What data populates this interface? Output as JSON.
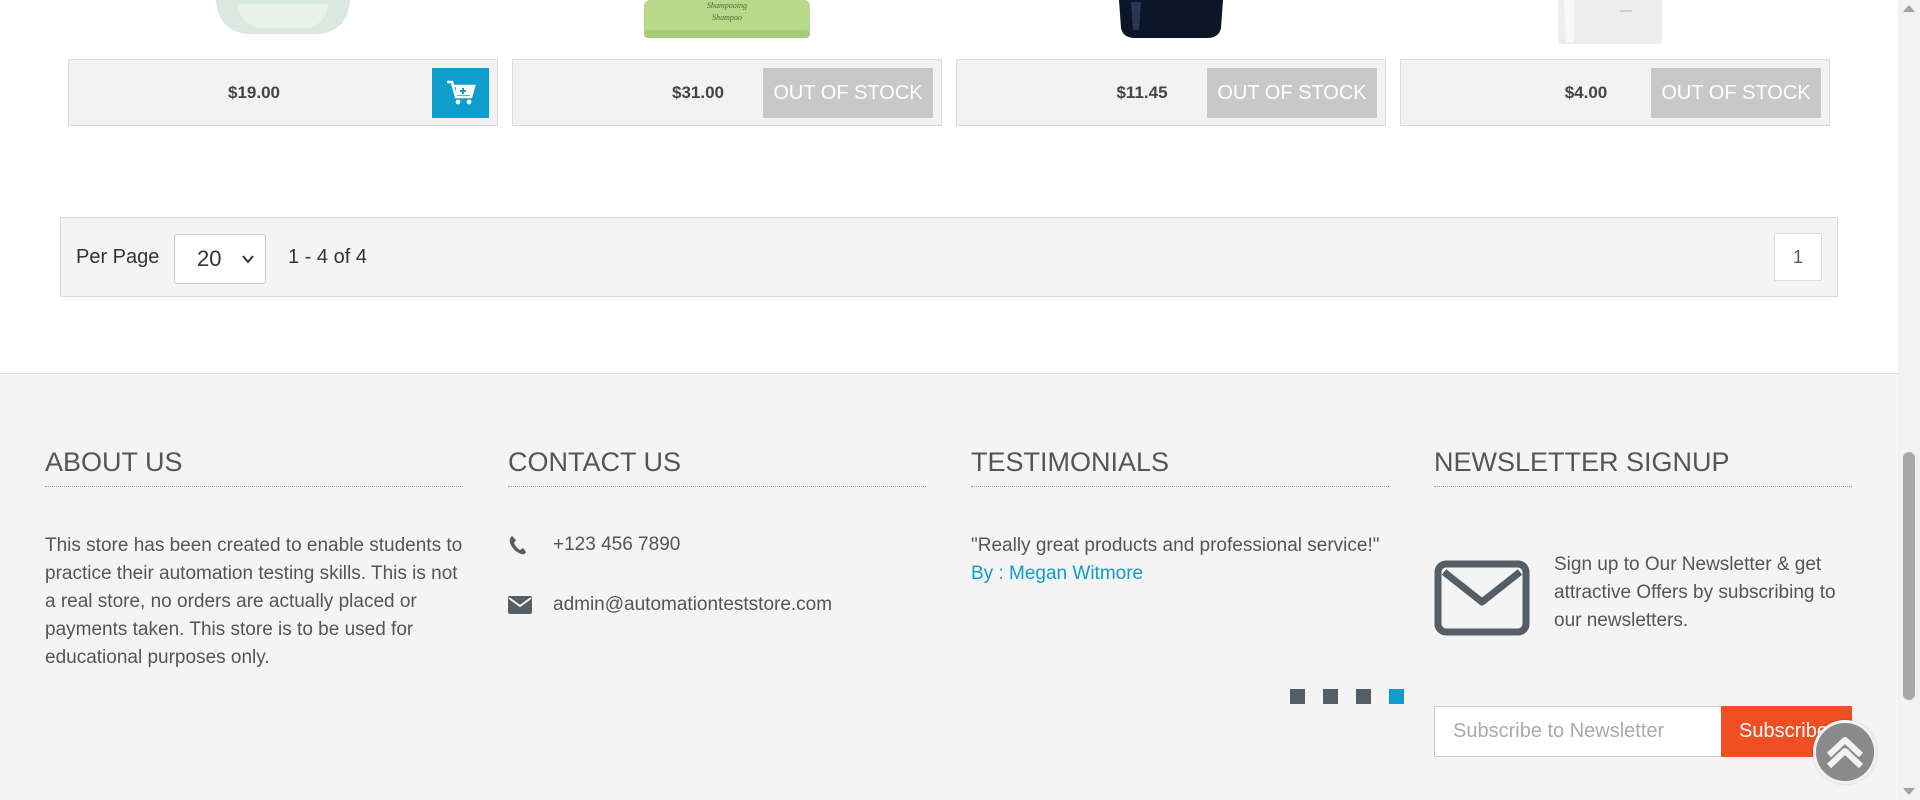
{
  "products": [
    {
      "price": "$19.00",
      "button": "cart",
      "cart_icon": "cart-plus-icon"
    },
    {
      "price": "$31.00",
      "button": "OUT OF STOCK",
      "bottle_label": "Shampooing Shampoo"
    },
    {
      "price": "$11.45",
      "button": "OUT OF STOCK"
    },
    {
      "price": "$4.00",
      "button": "OUT OF STOCK"
    }
  ],
  "pagination": {
    "per_page_label": "Per Page",
    "per_page_value": "20",
    "range_text": "1 - 4 of 4",
    "current_page": "1"
  },
  "footer": {
    "about": {
      "title": "ABOUT US",
      "text": "This store has been created to enable students to practice their automation testing skills. This is not a real store, no orders are actually placed or payments taken. This store is to be used for educational purposes only."
    },
    "contact": {
      "title": "CONTACT US",
      "phone": "+123 456 7890",
      "email": "admin@automationteststore.com",
      "phone_icon": "phone-icon",
      "email_icon": "envelope-icon"
    },
    "testimonials": {
      "title": "TESTIMONIALS",
      "quote": "\"Really great products and professional service!\"",
      "author": "By : Megan Witmore",
      "slide_count": 4,
      "active_slide": 4
    },
    "newsletter": {
      "title": "NEWSLETTER SIGNUP",
      "text": "Sign up to Our Newsletter & get attractive Offers by subscribing to our newsletters.",
      "placeholder": "Subscribe to Newsletter",
      "button": "Subscribe",
      "icon": "envelope-outline-icon"
    }
  },
  "colors": {
    "accent": "#0e9dcc",
    "subscribe": "#f04e23",
    "out_of_stock": "#c8c8c8"
  }
}
